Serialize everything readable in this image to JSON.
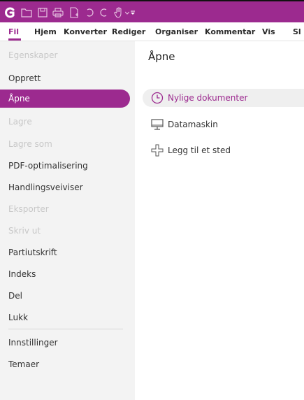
{
  "menubar": {
    "tabs": [
      {
        "label": "Fil"
      },
      {
        "label": "Hjem"
      },
      {
        "label": "Konverter"
      },
      {
        "label": "Rediger"
      },
      {
        "label": "Organiser"
      },
      {
        "label": "Kommentar"
      },
      {
        "label": "Vis"
      },
      {
        "label": "Sl"
      }
    ]
  },
  "sidebar": {
    "items": [
      {
        "label": "Egenskaper",
        "state": "disabled"
      },
      {
        "label": "Opprett",
        "state": "normal"
      },
      {
        "label": "Åpne",
        "state": "active"
      },
      {
        "label": "Lagre",
        "state": "disabled"
      },
      {
        "label": "Lagre som",
        "state": "disabled"
      },
      {
        "label": "PDF-optimalisering",
        "state": "normal"
      },
      {
        "label": "Handlingsveiviser",
        "state": "normal"
      },
      {
        "label": "Eksporter",
        "state": "disabled"
      },
      {
        "label": "Skriv ut",
        "state": "disabled"
      },
      {
        "label": "Partiutskrift",
        "state": "normal"
      },
      {
        "label": "Indeks",
        "state": "normal"
      },
      {
        "label": "Del",
        "state": "normal"
      },
      {
        "label": "Lukk",
        "state": "normal"
      },
      {
        "label": "Innstillinger",
        "state": "normal"
      },
      {
        "label": "Temaer",
        "state": "normal"
      }
    ]
  },
  "main": {
    "title": "Åpne",
    "options": [
      {
        "label": "Nylige dokumenter",
        "icon": "clock-icon",
        "selected": true
      },
      {
        "label": "Datamaskin",
        "icon": "monitor-icon",
        "selected": false
      },
      {
        "label": "Legg til et sted",
        "icon": "plus-icon",
        "selected": false
      }
    ]
  },
  "colors": {
    "accent": "#9c2a8f",
    "sidebar_bg": "#f3f3f3",
    "selected_bg": "#efefef",
    "disabled_text": "#c8c8c8"
  }
}
